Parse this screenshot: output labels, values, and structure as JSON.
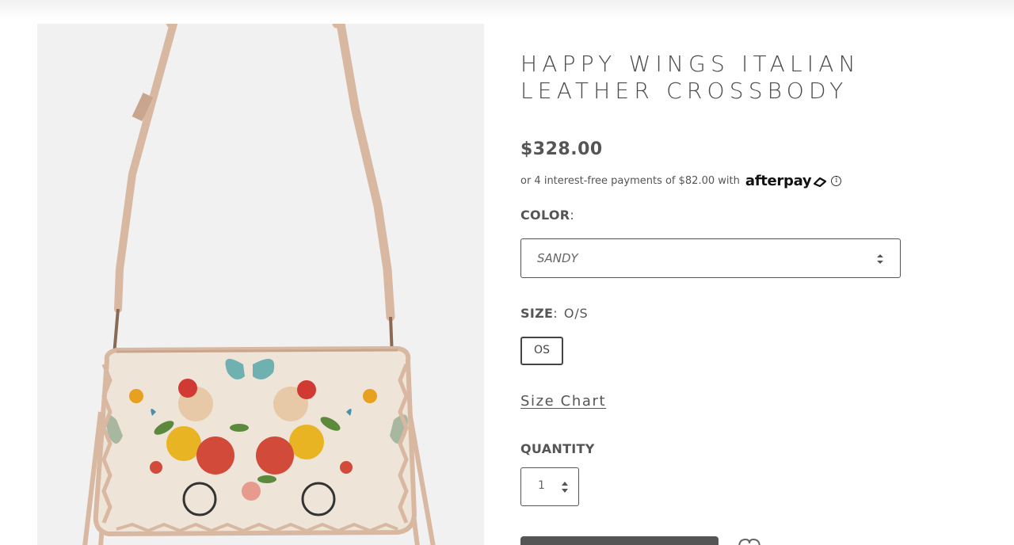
{
  "product": {
    "title": "HAPPY WINGS ITALIAN LEATHER CROSSBODY",
    "price": "$328.00",
    "image_alt": "Floral butterfly print leather crossbody bag"
  },
  "afterpay": {
    "text": "or 4 interest-free payments of $82.00 with",
    "brand": "afterpay",
    "info_glyph": "i"
  },
  "color": {
    "label": "COLOR",
    "colon": ":",
    "selected": "SANDY"
  },
  "size": {
    "label": "SIZE",
    "colon": ":",
    "value": "O/S",
    "options": [
      "OS"
    ]
  },
  "size_chart": {
    "label": "Size Chart"
  },
  "quantity": {
    "label": "QUANTITY",
    "value": "1"
  },
  "wishlist": {
    "label": "Wishlist"
  },
  "icons": {
    "select_arrows": "updown-chevron-icon",
    "quantity_spinner": "spinner-icon",
    "wishlist": "heart-icon",
    "afterpay_info": "info-icon"
  },
  "colors": {
    "text": "#555555",
    "image_bg": "#f1f1f1",
    "strap": "#dfc2ae",
    "button": "#555555"
  }
}
